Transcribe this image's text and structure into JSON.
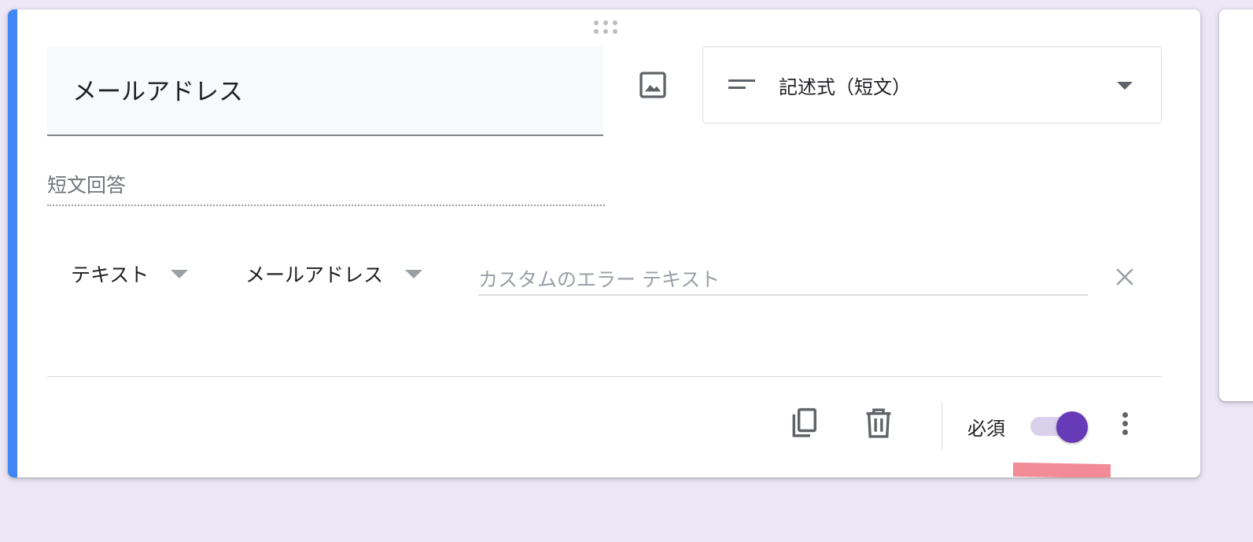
{
  "question": {
    "title": "メールアドレス",
    "type_label": "記述式（短文）",
    "answer_placeholder": "短文回答"
  },
  "validation": {
    "type_label": "テキスト",
    "rule_label": "メールアドレス",
    "error_placeholder": "カスタムのエラー テキスト",
    "error_value": ""
  },
  "footer": {
    "required_label": "必須",
    "required_on": true
  },
  "icons": {
    "drag": "drag-handle-icon",
    "image": "image-icon",
    "type": "short-text-icon",
    "close": "close-icon",
    "copy": "copy-icon",
    "delete": "trash-icon",
    "more": "more-vert-icon"
  },
  "colors": {
    "accent": "#4285f4",
    "toggle": "#673ab7",
    "background": "#ede7f6",
    "annotation": "#f28b95"
  }
}
